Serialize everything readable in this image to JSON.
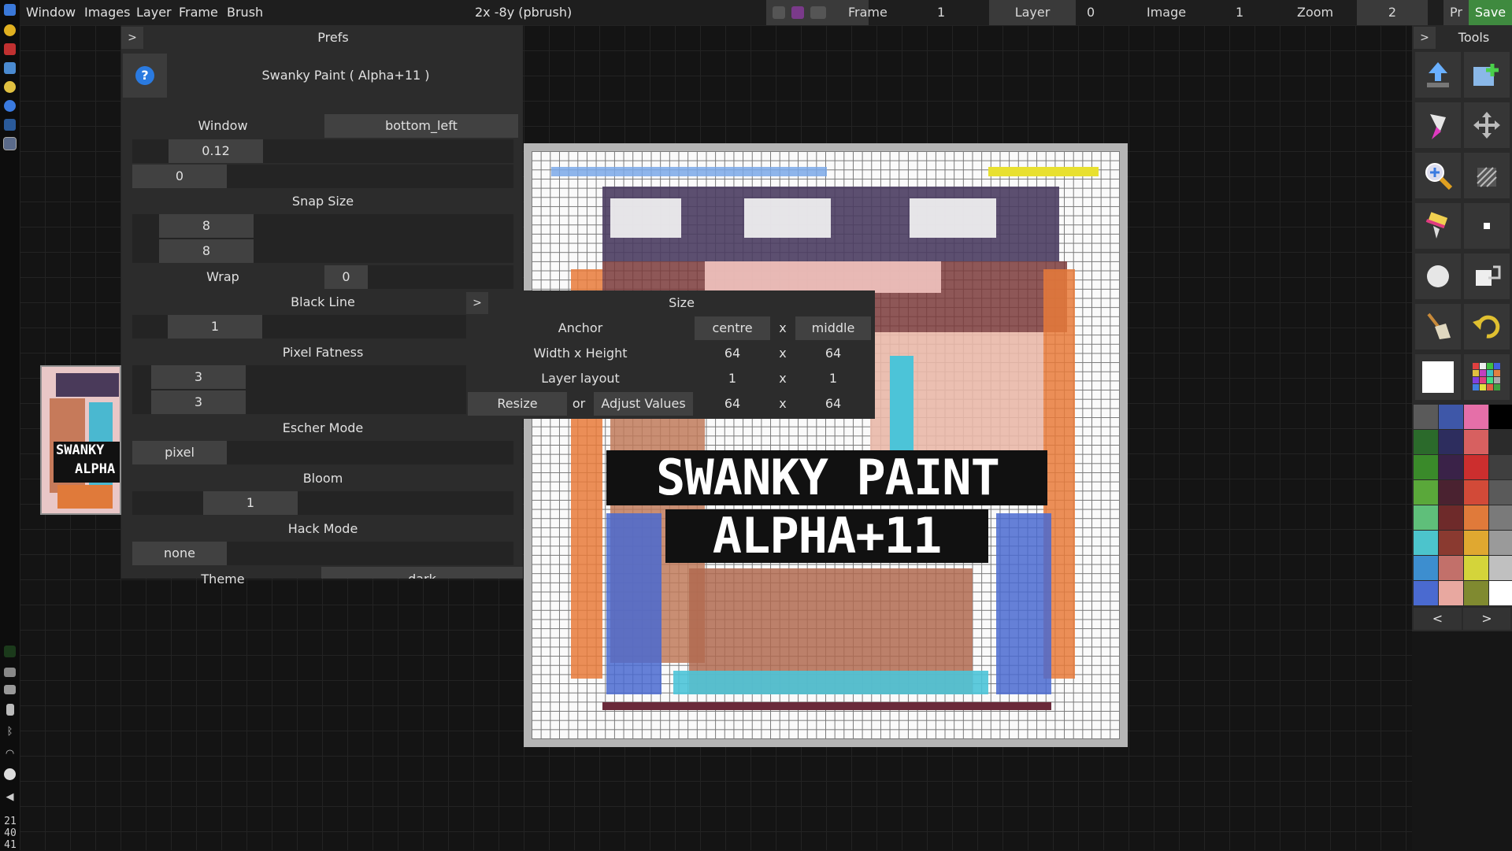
{
  "menubar": {
    "items": [
      "Window",
      "Images",
      "Layer",
      "Frame",
      "Brush"
    ],
    "status": "2x -8y (pbrush)",
    "frame_label": "Frame",
    "frame_value": "1",
    "layer_label": "Layer",
    "layer_value": "0",
    "image_label": "Image",
    "image_value": "1",
    "zoom_label": "Zoom",
    "zoom_value": "2",
    "pr_label": "Pr",
    "save_label": "Save"
  },
  "prefs": {
    "expander": ">",
    "title": "Prefs",
    "app_name": "Swanky Paint ( Alpha+11 )",
    "window_label": "Window",
    "window_value": "bottom_left",
    "window_scale": "0.12",
    "window_offset": "0",
    "snap_label": "Snap Size",
    "snap_x": "8",
    "snap_y": "8",
    "wrap_label": "Wrap",
    "wrap_value": "0",
    "black_line_label": "Black Line",
    "black_line_value": "1",
    "pixel_fatness_label": "Pixel Fatness",
    "pixel_fatness_x": "3",
    "pixel_fatness_y": "3",
    "escher_label": "Escher Mode",
    "escher_value": "pixel",
    "bloom_label": "Bloom",
    "bloom_value": "1",
    "hack_label": "Hack Mode",
    "hack_value": "none",
    "theme_label": "Theme",
    "theme_value": "dark"
  },
  "size": {
    "expander": ">",
    "title": "Size",
    "anchor_label": "Anchor",
    "anchor_x": "centre",
    "anchor_sep": "x",
    "anchor_y": "middle",
    "wh_label": "Width x Height",
    "width": "64",
    "height": "64",
    "layout_label": "Layer layout",
    "layout_x": "1",
    "layout_y": "1",
    "resize_label": "Resize",
    "or_label": "or",
    "adjust_label": "Adjust Values",
    "adjust_w": "64",
    "adjust_h": "64"
  },
  "tools": {
    "expander": ">",
    "title": "Tools",
    "items": [
      "upload-icon",
      "new-image-icon",
      "brush-pen-icon",
      "move-icon",
      "zoom-icon",
      "dither-icon",
      "paint-brush-icon",
      "pixel-dot-icon",
      "circle-icon",
      "layer-shift-icon",
      "broom-icon",
      "undo-icon",
      "white-color-icon",
      "palette-grid-icon"
    ],
    "prev_page": "<",
    "next_page": ">",
    "palette": [
      [
        "#5a5a5a",
        "#3e57a8",
        "#e56fa8",
        "#000000"
      ],
      [
        "#2b6a2b",
        "#2d2d5e",
        "#d76060",
        "#2b2b2b"
      ],
      [
        "#3a8a2a",
        "#3a2248",
        "#cc2e2e",
        "#3f3f3f"
      ],
      [
        "#5aa83a",
        "#4a2230",
        "#d24a38",
        "#5a5a5a"
      ],
      [
        "#5fbf7a",
        "#6e2a2a",
        "#e07a3a",
        "#7a7a7a"
      ],
      [
        "#4cc4cc",
        "#8a3a30",
        "#e0a830",
        "#9a9a9a"
      ],
      [
        "#3d8ecf",
        "#c2706a",
        "#d4d43a",
        "#c0c0c0"
      ],
      [
        "#4a6ad0",
        "#e8a8a0",
        "#808a30",
        "#ffffff"
      ]
    ]
  },
  "canvas": {
    "title_line1": "SWANKY PAINT",
    "title_line2": "ALPHA+11"
  },
  "thumbnail": {
    "line1": "SWANKY",
    "line2": "ALPHA"
  },
  "taskbar": {
    "clock": "21\n40\n41"
  }
}
